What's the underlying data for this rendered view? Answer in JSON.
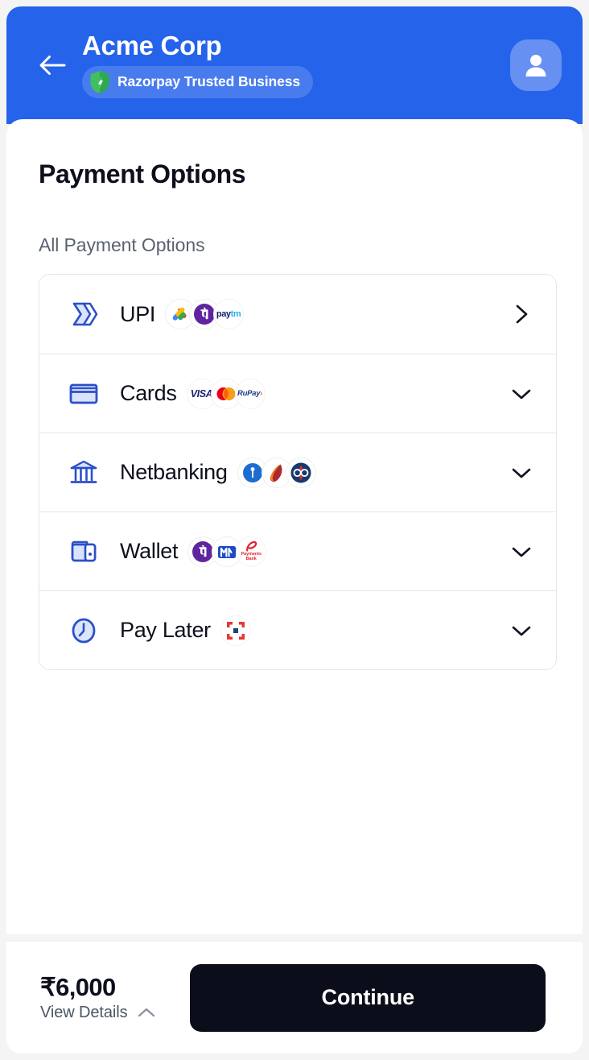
{
  "header": {
    "back_icon": "arrow-left-icon",
    "merchant_name": "Acme Corp",
    "trust_badge_text": "Razorpay Trusted Business",
    "trust_badge_icon": "shield-check-icon",
    "avatar_icon": "user-avatar-icon",
    "background_color": "#2563EB"
  },
  "main": {
    "page_title": "Payment Options",
    "section_label": "All Payment Options",
    "options": [
      {
        "id": "upi",
        "label": "UPI",
        "icon": "upi-arrows-icon",
        "chevron": "chevron-right-icon",
        "expandable": false,
        "logos": [
          "google-pay-logo",
          "phonepe-logo",
          "paytm-logo"
        ]
      },
      {
        "id": "cards",
        "label": "Cards",
        "icon": "credit-card-icon",
        "chevron": "chevron-down-icon",
        "expandable": true,
        "logos": [
          "visa-logo",
          "mastercard-logo",
          "rupay-logo"
        ]
      },
      {
        "id": "netbanking",
        "label": "Netbanking",
        "icon": "bank-icon",
        "chevron": "chevron-down-icon",
        "expandable": true,
        "logos": [
          "sbi-logo",
          "icici-logo",
          "bank-of-baroda-logo"
        ]
      },
      {
        "id": "wallet",
        "label": "Wallet",
        "icon": "wallet-icon",
        "chevron": "chevron-down-icon",
        "expandable": true,
        "logos": [
          "phonepe-logo",
          "mobikwik-logo",
          "airtel-payments-bank-logo"
        ]
      },
      {
        "id": "paylater",
        "label": "Pay Later",
        "icon": "clock-icon",
        "chevron": "chevron-down-icon",
        "expandable": true,
        "logos": [
          "simpl-logo"
        ]
      }
    ]
  },
  "footer": {
    "amount": "₹6,000",
    "view_details_label": "View Details",
    "view_details_icon": "chevron-up-icon",
    "continue_label": "Continue",
    "continue_color": "#0B0D1A"
  },
  "colors": {
    "brand_blue": "#2563EB",
    "icon_blue": "#2B50C8",
    "text_dark": "#0D0F1C",
    "text_muted": "#5A6270",
    "border": "#E4E6EA"
  }
}
